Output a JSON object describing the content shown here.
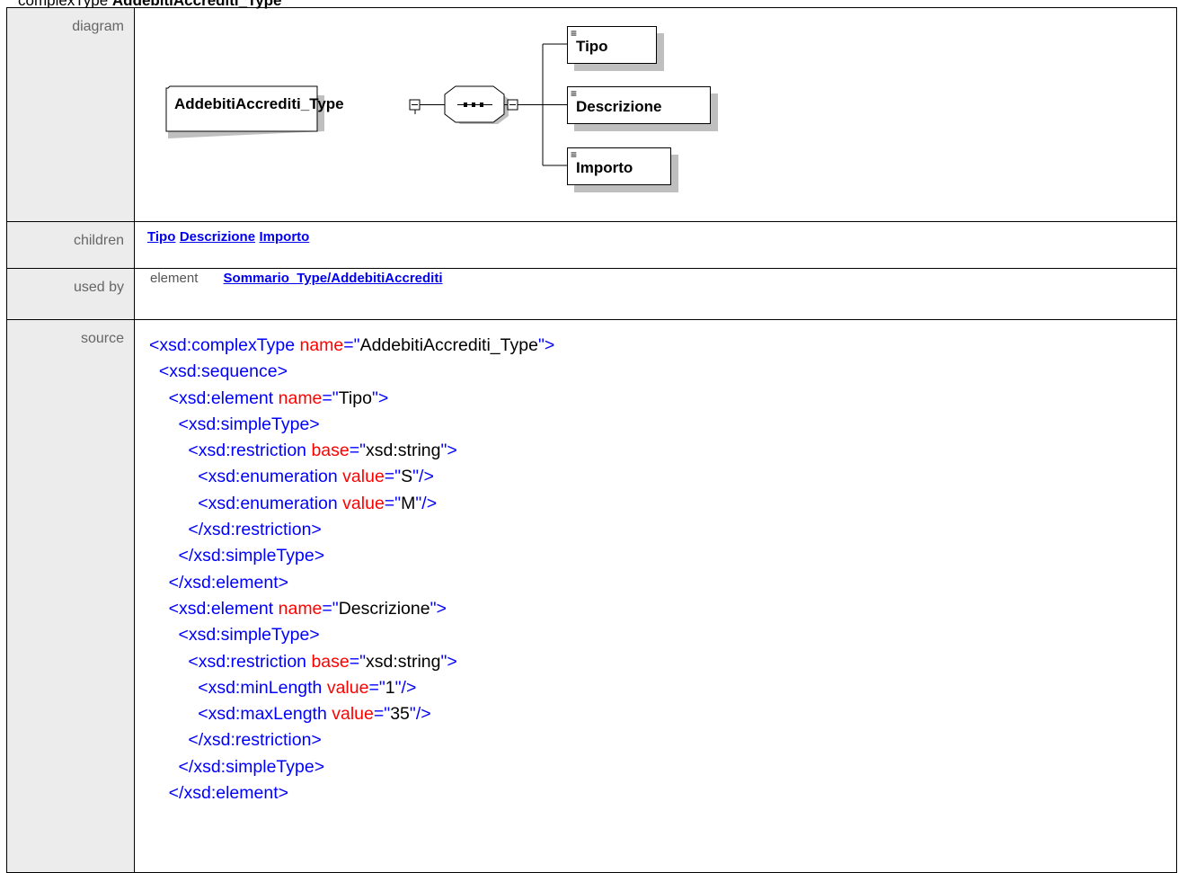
{
  "header": {
    "kind": "complexType",
    "name": "AddebitiAccrediti_Type"
  },
  "rows": {
    "diagram_label": "diagram",
    "children_label": "children",
    "usedby_label": "used by",
    "source_label": "source"
  },
  "diagram": {
    "root": "AddebitiAccrediti_Type",
    "compositor": "sequence",
    "children": [
      "Tipo",
      "Descrizione",
      "Importo"
    ]
  },
  "children_links": [
    "Tipo",
    "Descrizione",
    "Importo"
  ],
  "used_by": {
    "kind": "element",
    "ref": "Sommario_Type/AddebitiAccrediti"
  },
  "source_lines": [
    {
      "i": 0,
      "t": [
        [
          "tg",
          "<xsd:complexType "
        ],
        [
          "an",
          "name"
        ],
        [
          "tg",
          "=\""
        ],
        [
          "av",
          "AddebitiAccrediti_Type"
        ],
        [
          "tg",
          "\">"
        ]
      ]
    },
    {
      "i": 1,
      "t": [
        [
          "tg",
          "<xsd:sequence>"
        ]
      ]
    },
    {
      "i": 2,
      "t": [
        [
          "tg",
          "<xsd:element "
        ],
        [
          "an",
          "name"
        ],
        [
          "tg",
          "=\""
        ],
        [
          "av",
          "Tipo"
        ],
        [
          "tg",
          "\">"
        ]
      ]
    },
    {
      "i": 3,
      "t": [
        [
          "tg",
          "<xsd:simpleType>"
        ]
      ]
    },
    {
      "i": 4,
      "t": [
        [
          "tg",
          "<xsd:restriction "
        ],
        [
          "an",
          "base"
        ],
        [
          "tg",
          "=\""
        ],
        [
          "av",
          "xsd:string"
        ],
        [
          "tg",
          "\">"
        ]
      ]
    },
    {
      "i": 5,
      "t": [
        [
          "tg",
          "<xsd:enumeration "
        ],
        [
          "an",
          "value"
        ],
        [
          "tg",
          "=\""
        ],
        [
          "av",
          "S"
        ],
        [
          "tg",
          "\"/>"
        ]
      ]
    },
    {
      "i": 5,
      "t": [
        [
          "tg",
          "<xsd:enumeration "
        ],
        [
          "an",
          "value"
        ],
        [
          "tg",
          "=\""
        ],
        [
          "av",
          "M"
        ],
        [
          "tg",
          "\"/>"
        ]
      ]
    },
    {
      "i": 4,
      "t": [
        [
          "tg",
          "</xsd:restriction>"
        ]
      ]
    },
    {
      "i": 3,
      "t": [
        [
          "tg",
          "</xsd:simpleType>"
        ]
      ]
    },
    {
      "i": 2,
      "t": [
        [
          "tg",
          "</xsd:element>"
        ]
      ]
    },
    {
      "i": 2,
      "t": [
        [
          "tg",
          "<xsd:element "
        ],
        [
          "an",
          "name"
        ],
        [
          "tg",
          "=\""
        ],
        [
          "av",
          "Descrizione"
        ],
        [
          "tg",
          "\">"
        ]
      ]
    },
    {
      "i": 3,
      "t": [
        [
          "tg",
          "<xsd:simpleType>"
        ]
      ]
    },
    {
      "i": 4,
      "t": [
        [
          "tg",
          "<xsd:restriction "
        ],
        [
          "an",
          "base"
        ],
        [
          "tg",
          "=\""
        ],
        [
          "av",
          "xsd:string"
        ],
        [
          "tg",
          "\">"
        ]
      ]
    },
    {
      "i": 5,
      "t": [
        [
          "tg",
          "<xsd:minLength "
        ],
        [
          "an",
          "value"
        ],
        [
          "tg",
          "=\""
        ],
        [
          "av",
          "1"
        ],
        [
          "tg",
          "\"/>"
        ]
      ]
    },
    {
      "i": 5,
      "t": [
        [
          "tg",
          "<xsd:maxLength "
        ],
        [
          "an",
          "value"
        ],
        [
          "tg",
          "=\""
        ],
        [
          "av",
          "35"
        ],
        [
          "tg",
          "\"/>"
        ]
      ]
    },
    {
      "i": 4,
      "t": [
        [
          "tg",
          "</xsd:restriction>"
        ]
      ]
    },
    {
      "i": 3,
      "t": [
        [
          "tg",
          "</xsd:simpleType>"
        ]
      ]
    },
    {
      "i": 2,
      "t": [
        [
          "tg",
          "</xsd:element>"
        ]
      ]
    }
  ]
}
